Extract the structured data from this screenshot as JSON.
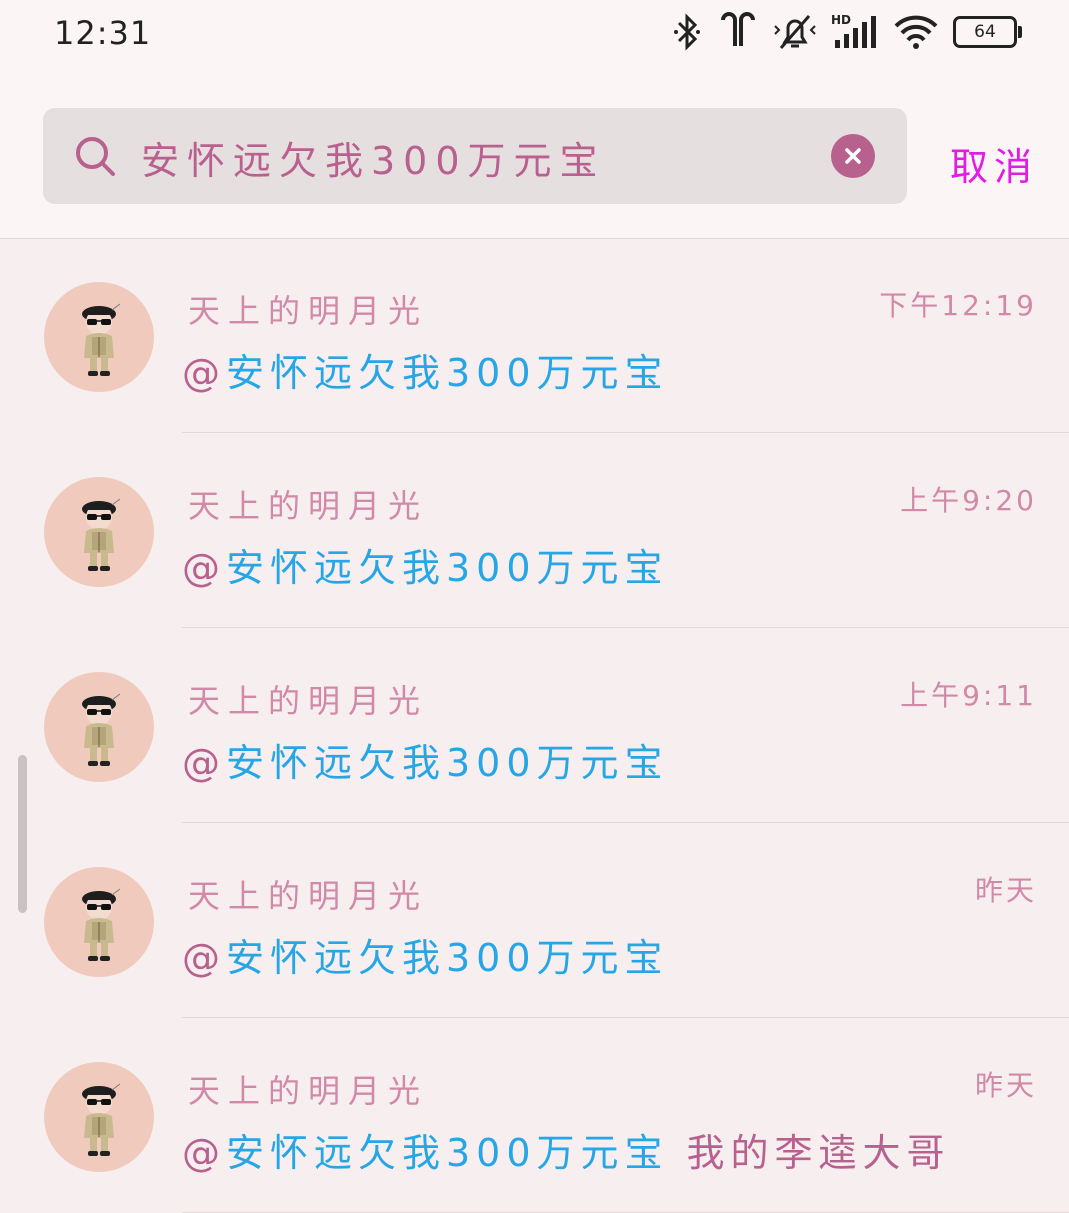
{
  "status_bar": {
    "time": "12:31",
    "battery": "64",
    "icons": [
      "bluetooth-icon",
      "earbuds-icon",
      "mute-icon",
      "signal-hd-icon",
      "wifi-icon",
      "battery-icon"
    ]
  },
  "search": {
    "query": "安怀远欠我300万元宝",
    "cancel_label": "取消"
  },
  "colors": {
    "accent": "#b8608e",
    "mention": "#27a6e6",
    "cancel": "#e21be6",
    "sender": "#d08aa8"
  },
  "results": [
    {
      "sender": "天上的明月光",
      "time": "下午12:19",
      "at": "@",
      "mention": "安怀远欠我300万元宝",
      "extra": ""
    },
    {
      "sender": "天上的明月光",
      "time": "上午9:20",
      "at": "@",
      "mention": "安怀远欠我300万元宝",
      "extra": ""
    },
    {
      "sender": "天上的明月光",
      "time": "上午9:11",
      "at": "@",
      "mention": "安怀远欠我300万元宝",
      "extra": ""
    },
    {
      "sender": "天上的明月光",
      "time": "昨天",
      "at": "@",
      "mention": "安怀远欠我300万元宝",
      "extra": ""
    },
    {
      "sender": "天上的明月光",
      "time": "昨天",
      "at": "@",
      "mention": "安怀远欠我300万元宝",
      "extra": "我的李逵大哥"
    }
  ]
}
